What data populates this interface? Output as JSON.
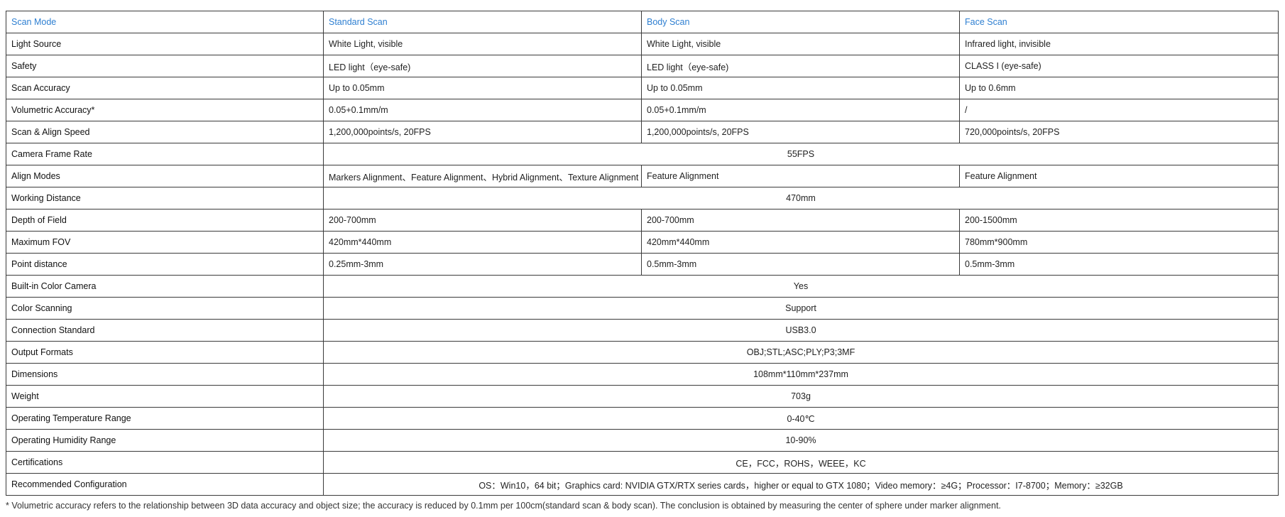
{
  "header": {
    "label": "Scan Mode",
    "modes": [
      "Standard Scan",
      "Body Scan",
      "Face Scan"
    ]
  },
  "rows": [
    {
      "label": "Light Source",
      "values": [
        "White Light, visible",
        "White Light, visible",
        "Infrared light, invisible"
      ]
    },
    {
      "label": "Safety",
      "values": [
        "LED light（eye-safe)",
        "LED light（eye-safe)",
        "CLASS I (eye-safe)"
      ]
    },
    {
      "label": "Scan Accuracy",
      "values": [
        "Up to 0.05mm",
        "Up to 0.05mm",
        "Up to 0.6mm"
      ]
    },
    {
      "label": "Volumetric Accuracy*",
      "values": [
        "0.05+0.1mm/m",
        "0.05+0.1mm/m",
        "/"
      ]
    },
    {
      "label": "Scan & Align Speed",
      "values": [
        "1,200,000points/s, 20FPS",
        "1,200,000points/s, 20FPS",
        "720,000points/s, 20FPS"
      ]
    },
    {
      "label": "Camera Frame Rate",
      "span": "55FPS"
    },
    {
      "label": "Align Modes",
      "values": [
        "Markers Alignment、Feature Alignment、Hybrid Alignment、Texture Alignment",
        "Feature Alignment",
        "Feature Alignment"
      ]
    },
    {
      "label": "Working Distance",
      "span": "470mm"
    },
    {
      "label": "Depth of Field",
      "values": [
        "200-700mm",
        "200-700mm",
        "200-1500mm"
      ]
    },
    {
      "label": "Maximum FOV",
      "values": [
        "420mm*440mm",
        "420mm*440mm",
        "780mm*900mm"
      ]
    },
    {
      "label": "Point distance",
      "values": [
        "0.25mm-3mm",
        "0.5mm-3mm",
        "0.5mm-3mm"
      ]
    },
    {
      "label": "Built-in Color Camera",
      "span": "Yes"
    },
    {
      "label": "Color Scanning",
      "span": "Support"
    },
    {
      "label": "Connection Standard",
      "span": "USB3.0"
    },
    {
      "label": "Output Formats",
      "span": "OBJ;STL;ASC;PLY;P3;3MF"
    },
    {
      "label": "Dimensions",
      "span": "108mm*110mm*237mm"
    },
    {
      "label": "Weight",
      "span": "703g"
    },
    {
      "label": "Operating Temperature Range",
      "span": "0-40℃"
    },
    {
      "label": "Operating Humidity Range",
      "span": "10-90%"
    },
    {
      "label": "Certifications",
      "span": "CE，FCC，ROHS，WEEE，KC"
    },
    {
      "label": "Recommended Configuration",
      "span": "OS：Win10，64 bit；Graphics card: NVIDIA GTX/RTX series cards，higher or equal to GTX 1080；Video memory：≥4G；Processor：I7-8700；Memory：≥32GB"
    }
  ],
  "footnote": "* Volumetric accuracy refers to the relationship between 3D data accuracy and object size; the accuracy is reduced by 0.1mm per 100cm(standard scan & body scan). The conclusion is obtained by measuring the center of sphere under marker alignment.",
  "colors": {
    "header_text": "#2e7fd1",
    "border": "#3a3a3a"
  }
}
